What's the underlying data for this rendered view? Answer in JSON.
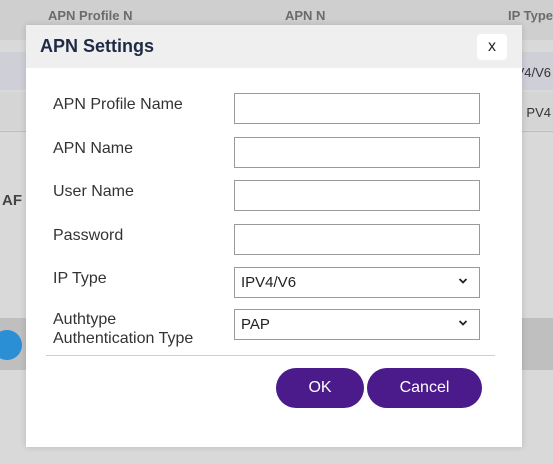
{
  "background": {
    "columns": [
      "APN Profile N",
      "APN N",
      "IP Type"
    ],
    "rows": [
      {
        "ip_type": "V4/V6"
      },
      {
        "ip_type": "PV4"
      }
    ],
    "side_label": "AF"
  },
  "dialog": {
    "title": "APN Settings",
    "close_label": "x",
    "fields": {
      "apn_profile_name": {
        "label": "APN Profile Name",
        "value": ""
      },
      "apn_name": {
        "label": "APN Name",
        "value": ""
      },
      "user_name": {
        "label": "User Name",
        "value": ""
      },
      "password": {
        "label": "Password",
        "value": ""
      },
      "ip_type": {
        "label": "IP Type",
        "selected": "IPV4/V6"
      },
      "authtype": {
        "label_line1": "Authtype",
        "label_line2": "Authentication Type",
        "selected": "PAP"
      }
    },
    "ok_label": "OK",
    "cancel_label": "Cancel"
  },
  "colors": {
    "primary_button": "#4b1b8c",
    "header_bg": "#efefef",
    "overlay_bg": "#d9d9d9"
  },
  "icons": {
    "close": "close-icon",
    "dropdown": "chevron-down-icon"
  }
}
